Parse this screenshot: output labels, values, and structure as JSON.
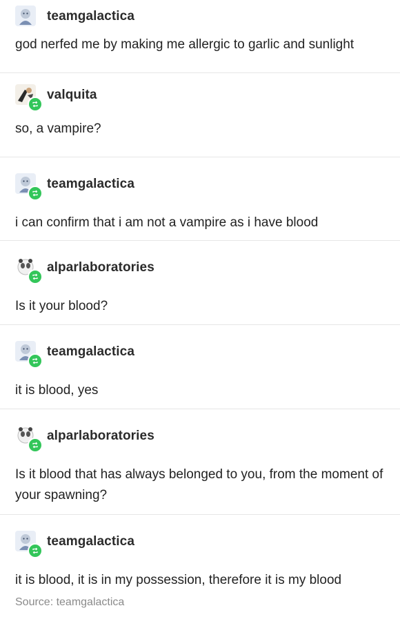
{
  "posts": [
    {
      "username": "teamgalactica",
      "text": "god nerfed me by making me allergic to garlic and sunlight",
      "avatar": "teamgalactica-avatar",
      "reblog_badge": false
    },
    {
      "username": "valquita",
      "text": "so, a vampire?",
      "avatar": "valquita-avatar",
      "reblog_badge": true
    },
    {
      "username": "teamgalactica",
      "text": "i can confirm that i am not a vampire as i have blood",
      "avatar": "teamgalactica-avatar",
      "reblog_badge": true
    },
    {
      "username": "alparlaboratories",
      "text": "Is it your blood?",
      "avatar": "alparlaboratories-avatar",
      "reblog_badge": true
    },
    {
      "username": "teamgalactica",
      "text": "it is blood, yes",
      "avatar": "teamgalactica-avatar",
      "reblog_badge": true
    },
    {
      "username": "alparlaboratories",
      "text": "Is it blood that has always belonged to you, from the moment of your spawning?",
      "avatar": "alparlaboratories-avatar",
      "reblog_badge": true
    },
    {
      "username": "teamgalactica",
      "text": "it is blood, it is in my possession, therefore it is my blood",
      "avatar": "teamgalactica-avatar",
      "reblog_badge": true
    }
  ],
  "source": "Source: teamgalactica",
  "colors": {
    "reblog_badge": "#33c65a",
    "divider": "#e6e6e6"
  }
}
